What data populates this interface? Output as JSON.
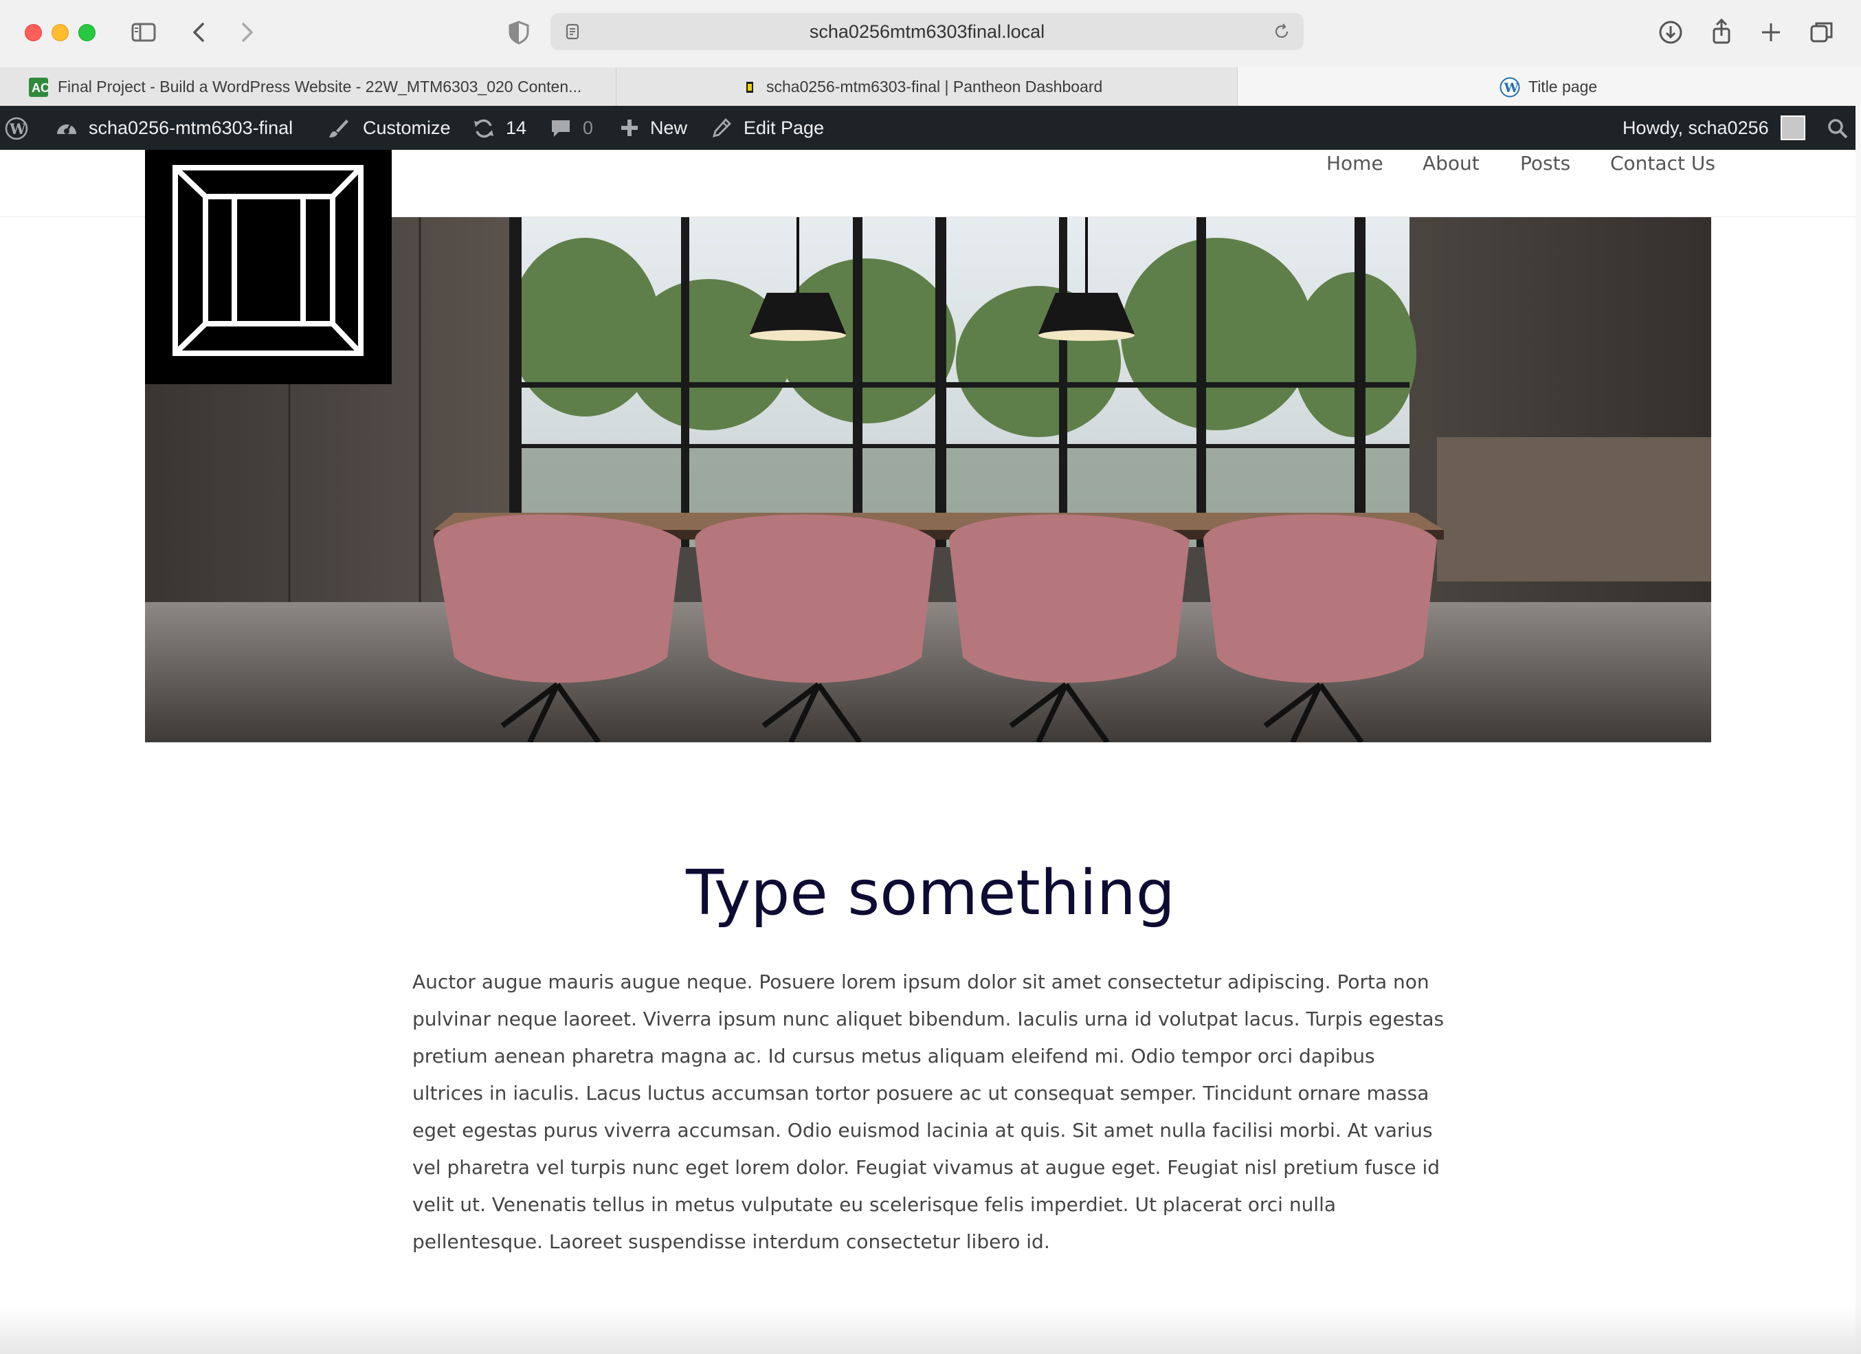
{
  "browser": {
    "url": "scha0256mtm6303final.local",
    "tabs": [
      {
        "label": "Final Project - Build a WordPress Website - 22W_MTM6303_020 Conten...",
        "icon": "canvas-icon"
      },
      {
        "label": "scha0256-mtm6303-final | Pantheon Dashboard",
        "icon": "pantheon-icon"
      },
      {
        "label": "Title page",
        "icon": "wordpress-icon"
      }
    ]
  },
  "admin_bar": {
    "site_name": "scha0256-mtm6303-final",
    "customize": "Customize",
    "updates_count": "14",
    "comments_count": "0",
    "new_label": "New",
    "edit_page": "Edit Page",
    "howdy": "Howdy, scha0256"
  },
  "nav": {
    "items": [
      "Home",
      "About",
      "Posts",
      "Contact Us"
    ]
  },
  "page": {
    "title": "Type something",
    "body": "Auctor augue mauris augue neque. Posuere lorem ipsum dolor sit amet consectetur adipiscing. Porta non pulvinar neque laoreet. Viverra ipsum nunc aliquet bibendum. Iaculis urna id volutpat lacus. Turpis egestas pretium aenean pharetra magna ac. Id cursus metus aliquam eleifend mi. Odio tempor orci dapibus ultrices in iaculis. Lacus luctus accumsan tortor posuere ac ut consequat semper. Tincidunt ornare massa eget egestas purus viverra accumsan. Odio euismod lacinia at quis. Sit amet nulla facilisi morbi. At varius vel pharetra vel turpis nunc eget lorem dolor. Feugiat vivamus at augue eget. Feugiat nisl pretium fusce id velit ut. Venenatis tellus in metus vulputate eu scelerisque felis imperdiet. Ut placerat orci nulla pellentesque. Laoreet suspendisse interdum consectetur libero id."
  },
  "colors": {
    "admin_bar_bg": "#1d2327",
    "title_color": "#0e0b33",
    "body_color": "#444444",
    "nav_color": "#555555"
  }
}
